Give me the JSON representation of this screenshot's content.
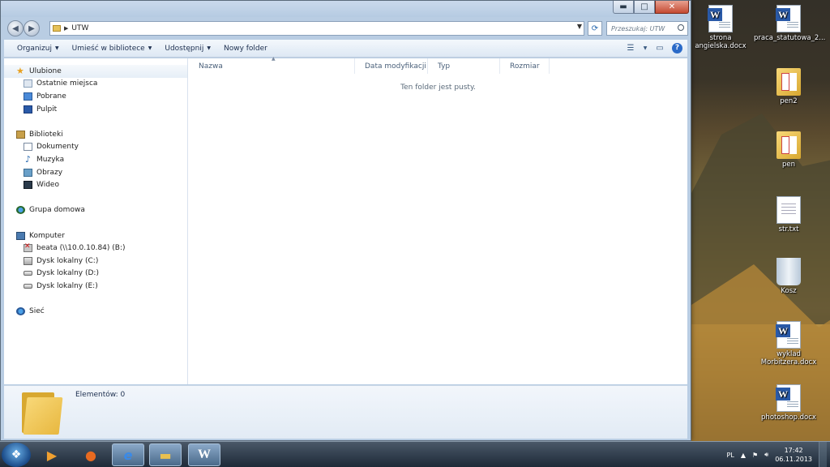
{
  "window": {
    "address": {
      "path": "UTW"
    },
    "search": {
      "placeholder": "Przeszukaj: UTW"
    },
    "toolbar": {
      "organize": "Organizuj",
      "include_in_library": "Umieść w bibliotece",
      "share": "Udostępnij",
      "new_folder": "Nowy folder"
    },
    "nav": {
      "favorites": "Ulubione",
      "recent": "Ostatnie miejsca",
      "downloads": "Pobrane",
      "desktop": "Pulpit",
      "libraries": "Biblioteki",
      "documents": "Dokumenty",
      "music": "Muzyka",
      "pictures": "Obrazy",
      "videos": "Wideo",
      "homegroup": "Grupa domowa",
      "computer": "Komputer",
      "drive_b": "beata (\\\\10.0.10.84) (B:)",
      "drive_c": "Dysk lokalny (C:)",
      "drive_d": "Dysk lokalny (D:)",
      "drive_e": "Dysk lokalny (E:)",
      "network": "Sieć"
    },
    "columns": [
      "Nazwa",
      "Data modyfikacji",
      "Typ",
      "Rozmiar"
    ],
    "empty_message": "Ten folder jest pusty.",
    "details": {
      "item_count": "Elementów: 0"
    }
  },
  "desktop_icons": [
    {
      "label": "strona angielska.docx",
      "type": "word"
    },
    {
      "label": "praca_statutowa_2...",
      "type": "word"
    },
    {
      "label": "pen2",
      "type": "folder"
    },
    {
      "label": "pen",
      "type": "folder"
    },
    {
      "label": "str.txt",
      "type": "text"
    },
    {
      "label": "Kosz",
      "type": "recycle-bin"
    },
    {
      "label": "wyklad Morbitzera.docx",
      "type": "word"
    },
    {
      "label": "photoshop.docx",
      "type": "word"
    }
  ],
  "taskbar": {
    "language": "PL",
    "time": "17:42",
    "date": "06.11.2013"
  }
}
